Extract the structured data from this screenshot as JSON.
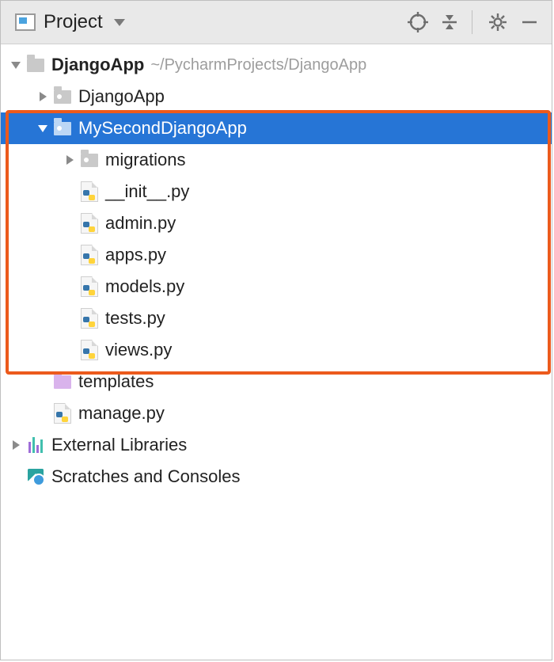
{
  "header": {
    "label": "Project"
  },
  "tree": {
    "root": {
      "name": "DjangoApp",
      "path": "~/PycharmProjects/DjangoApp"
    },
    "djangoapp_inner": "DjangoApp",
    "mysecond": "MySecondDjangoApp",
    "migrations": "migrations",
    "files": {
      "init": "__init__.py",
      "admin": "admin.py",
      "apps": "apps.py",
      "models": "models.py",
      "tests": "tests.py",
      "views": "views.py"
    },
    "templates": "templates",
    "manage": "manage.py",
    "external": "External Libraries",
    "scratches": "Scratches and Consoles"
  }
}
